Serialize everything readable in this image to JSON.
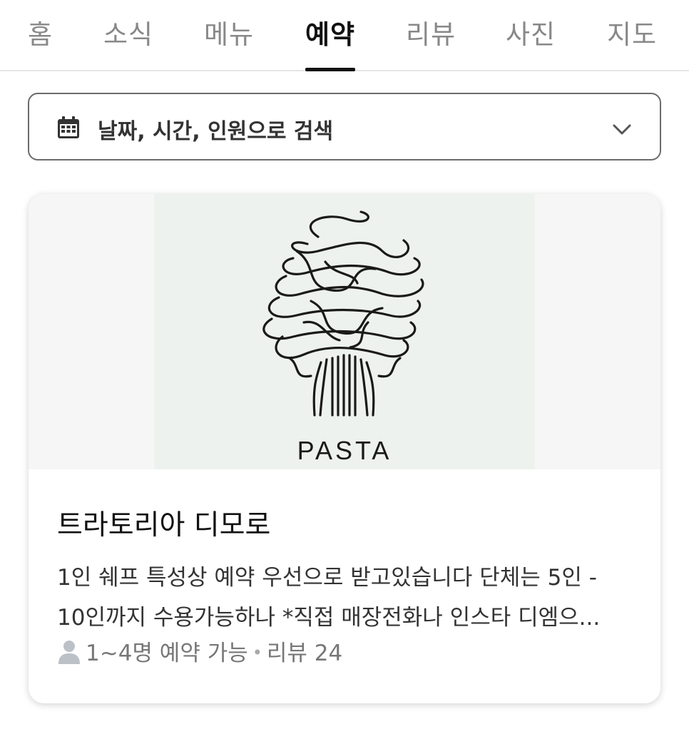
{
  "tabs": [
    {
      "label": "홈",
      "active": false
    },
    {
      "label": "소식",
      "active": false
    },
    {
      "label": "메뉴",
      "active": false
    },
    {
      "label": "예약",
      "active": true
    },
    {
      "label": "리뷰",
      "active": false
    },
    {
      "label": "사진",
      "active": false
    },
    {
      "label": "지도",
      "active": false
    }
  ],
  "search": {
    "label": "날짜, 시간, 인원으로 검색",
    "icon": "calendar-icon",
    "dropdown_icon": "chevron-down-icon"
  },
  "card": {
    "image_text": "PASTA",
    "title": "트라토리아 디모로",
    "desc_line1": "1인 쉐프 특성상 예약 우선으로 받고있습니다 단체는 5인 -",
    "desc_line2": "10인까지 수용가능하나 *직접 매장전화나 인스타 디엠으...",
    "capacity": "1~4명 예약 가능",
    "separator": "•",
    "reviews": "리뷰 24"
  },
  "colors": {
    "active_tab": "#111111",
    "inactive_tab": "#888888",
    "image_bg": "#eef2ee"
  }
}
